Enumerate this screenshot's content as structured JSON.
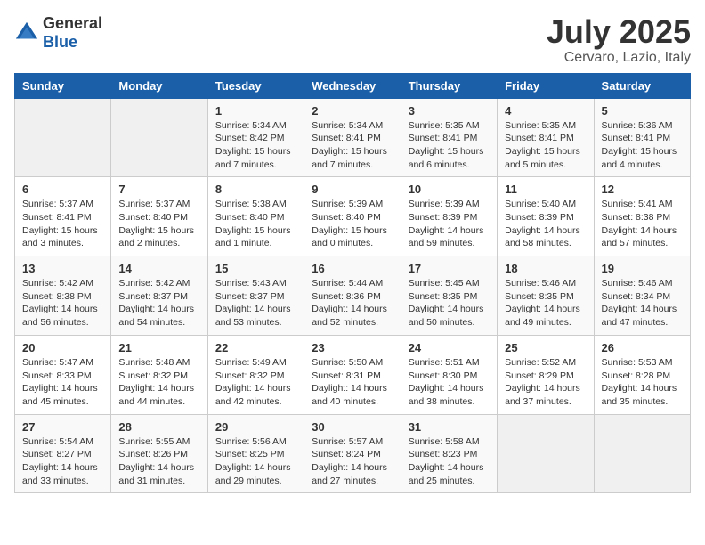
{
  "header": {
    "logo_general": "General",
    "logo_blue": "Blue",
    "title": "July 2025",
    "subtitle": "Cervaro, Lazio, Italy"
  },
  "weekdays": [
    "Sunday",
    "Monday",
    "Tuesday",
    "Wednesday",
    "Thursday",
    "Friday",
    "Saturday"
  ],
  "weeks": [
    [
      {
        "day": "",
        "sunrise": "",
        "sunset": "",
        "daylight": "",
        "empty": true
      },
      {
        "day": "",
        "sunrise": "",
        "sunset": "",
        "daylight": "",
        "empty": true
      },
      {
        "day": "1",
        "sunrise": "Sunrise: 5:34 AM",
        "sunset": "Sunset: 8:42 PM",
        "daylight": "Daylight: 15 hours and 7 minutes."
      },
      {
        "day": "2",
        "sunrise": "Sunrise: 5:34 AM",
        "sunset": "Sunset: 8:41 PM",
        "daylight": "Daylight: 15 hours and 7 minutes."
      },
      {
        "day": "3",
        "sunrise": "Sunrise: 5:35 AM",
        "sunset": "Sunset: 8:41 PM",
        "daylight": "Daylight: 15 hours and 6 minutes."
      },
      {
        "day": "4",
        "sunrise": "Sunrise: 5:35 AM",
        "sunset": "Sunset: 8:41 PM",
        "daylight": "Daylight: 15 hours and 5 minutes."
      },
      {
        "day": "5",
        "sunrise": "Sunrise: 5:36 AM",
        "sunset": "Sunset: 8:41 PM",
        "daylight": "Daylight: 15 hours and 4 minutes."
      }
    ],
    [
      {
        "day": "6",
        "sunrise": "Sunrise: 5:37 AM",
        "sunset": "Sunset: 8:41 PM",
        "daylight": "Daylight: 15 hours and 3 minutes."
      },
      {
        "day": "7",
        "sunrise": "Sunrise: 5:37 AM",
        "sunset": "Sunset: 8:40 PM",
        "daylight": "Daylight: 15 hours and 2 minutes."
      },
      {
        "day": "8",
        "sunrise": "Sunrise: 5:38 AM",
        "sunset": "Sunset: 8:40 PM",
        "daylight": "Daylight: 15 hours and 1 minute."
      },
      {
        "day": "9",
        "sunrise": "Sunrise: 5:39 AM",
        "sunset": "Sunset: 8:40 PM",
        "daylight": "Daylight: 15 hours and 0 minutes."
      },
      {
        "day": "10",
        "sunrise": "Sunrise: 5:39 AM",
        "sunset": "Sunset: 8:39 PM",
        "daylight": "Daylight: 14 hours and 59 minutes."
      },
      {
        "day": "11",
        "sunrise": "Sunrise: 5:40 AM",
        "sunset": "Sunset: 8:39 PM",
        "daylight": "Daylight: 14 hours and 58 minutes."
      },
      {
        "day": "12",
        "sunrise": "Sunrise: 5:41 AM",
        "sunset": "Sunset: 8:38 PM",
        "daylight": "Daylight: 14 hours and 57 minutes."
      }
    ],
    [
      {
        "day": "13",
        "sunrise": "Sunrise: 5:42 AM",
        "sunset": "Sunset: 8:38 PM",
        "daylight": "Daylight: 14 hours and 56 minutes."
      },
      {
        "day": "14",
        "sunrise": "Sunrise: 5:42 AM",
        "sunset": "Sunset: 8:37 PM",
        "daylight": "Daylight: 14 hours and 54 minutes."
      },
      {
        "day": "15",
        "sunrise": "Sunrise: 5:43 AM",
        "sunset": "Sunset: 8:37 PM",
        "daylight": "Daylight: 14 hours and 53 minutes."
      },
      {
        "day": "16",
        "sunrise": "Sunrise: 5:44 AM",
        "sunset": "Sunset: 8:36 PM",
        "daylight": "Daylight: 14 hours and 52 minutes."
      },
      {
        "day": "17",
        "sunrise": "Sunrise: 5:45 AM",
        "sunset": "Sunset: 8:35 PM",
        "daylight": "Daylight: 14 hours and 50 minutes."
      },
      {
        "day": "18",
        "sunrise": "Sunrise: 5:46 AM",
        "sunset": "Sunset: 8:35 PM",
        "daylight": "Daylight: 14 hours and 49 minutes."
      },
      {
        "day": "19",
        "sunrise": "Sunrise: 5:46 AM",
        "sunset": "Sunset: 8:34 PM",
        "daylight": "Daylight: 14 hours and 47 minutes."
      }
    ],
    [
      {
        "day": "20",
        "sunrise": "Sunrise: 5:47 AM",
        "sunset": "Sunset: 8:33 PM",
        "daylight": "Daylight: 14 hours and 45 minutes."
      },
      {
        "day": "21",
        "sunrise": "Sunrise: 5:48 AM",
        "sunset": "Sunset: 8:32 PM",
        "daylight": "Daylight: 14 hours and 44 minutes."
      },
      {
        "day": "22",
        "sunrise": "Sunrise: 5:49 AM",
        "sunset": "Sunset: 8:32 PM",
        "daylight": "Daylight: 14 hours and 42 minutes."
      },
      {
        "day": "23",
        "sunrise": "Sunrise: 5:50 AM",
        "sunset": "Sunset: 8:31 PM",
        "daylight": "Daylight: 14 hours and 40 minutes."
      },
      {
        "day": "24",
        "sunrise": "Sunrise: 5:51 AM",
        "sunset": "Sunset: 8:30 PM",
        "daylight": "Daylight: 14 hours and 38 minutes."
      },
      {
        "day": "25",
        "sunrise": "Sunrise: 5:52 AM",
        "sunset": "Sunset: 8:29 PM",
        "daylight": "Daylight: 14 hours and 37 minutes."
      },
      {
        "day": "26",
        "sunrise": "Sunrise: 5:53 AM",
        "sunset": "Sunset: 8:28 PM",
        "daylight": "Daylight: 14 hours and 35 minutes."
      }
    ],
    [
      {
        "day": "27",
        "sunrise": "Sunrise: 5:54 AM",
        "sunset": "Sunset: 8:27 PM",
        "daylight": "Daylight: 14 hours and 33 minutes."
      },
      {
        "day": "28",
        "sunrise": "Sunrise: 5:55 AM",
        "sunset": "Sunset: 8:26 PM",
        "daylight": "Daylight: 14 hours and 31 minutes."
      },
      {
        "day": "29",
        "sunrise": "Sunrise: 5:56 AM",
        "sunset": "Sunset: 8:25 PM",
        "daylight": "Daylight: 14 hours and 29 minutes."
      },
      {
        "day": "30",
        "sunrise": "Sunrise: 5:57 AM",
        "sunset": "Sunset: 8:24 PM",
        "daylight": "Daylight: 14 hours and 27 minutes."
      },
      {
        "day": "31",
        "sunrise": "Sunrise: 5:58 AM",
        "sunset": "Sunset: 8:23 PM",
        "daylight": "Daylight: 14 hours and 25 minutes."
      },
      {
        "day": "",
        "sunrise": "",
        "sunset": "",
        "daylight": "",
        "empty": true
      },
      {
        "day": "",
        "sunrise": "",
        "sunset": "",
        "daylight": "",
        "empty": true
      }
    ]
  ]
}
